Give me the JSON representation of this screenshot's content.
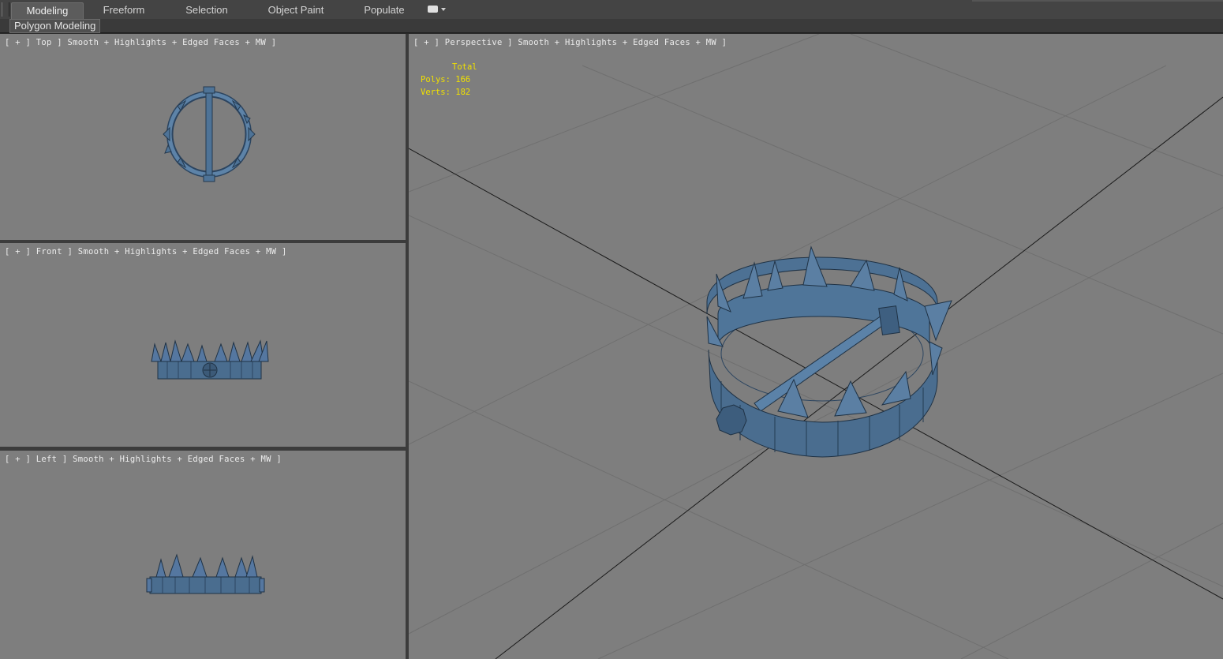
{
  "ribbon": {
    "tabs": [
      {
        "label": "Modeling",
        "active": true
      },
      {
        "label": "Freeform",
        "active": false
      },
      {
        "label": "Selection",
        "active": false
      },
      {
        "label": "Object Paint",
        "active": false
      },
      {
        "label": "Populate",
        "active": false
      }
    ],
    "options_icon": "dropdown-box-icon",
    "panel_label": "Polygon Modeling"
  },
  "viewports": {
    "top": {
      "label": "[ + ] Top ] Smooth + Highlights + Edged Faces + MW ]"
    },
    "front": {
      "label": "[ + ] Front ] Smooth + Highlights + Edged Faces + MW ]"
    },
    "left": {
      "label": "[ + ] Left ] Smooth + Highlights + Edged Faces + MW ]"
    },
    "perspective": {
      "label": "[ + ] Perspective ] Smooth + Highlights + Edged Faces + MW ]"
    }
  },
  "stats": {
    "header": "Total",
    "polys_label": "Polys:",
    "polys_value": "166",
    "verts_label": "Verts:",
    "verts_value": "182"
  },
  "colors": {
    "viewport_bg": "#7e7e7e",
    "stats_text": "#f0e000",
    "model_blue": "#4a6d8f",
    "model_dark": "#2c4560",
    "grid_line": "#6e6e6e",
    "axis_line": "#1a1a1a"
  }
}
